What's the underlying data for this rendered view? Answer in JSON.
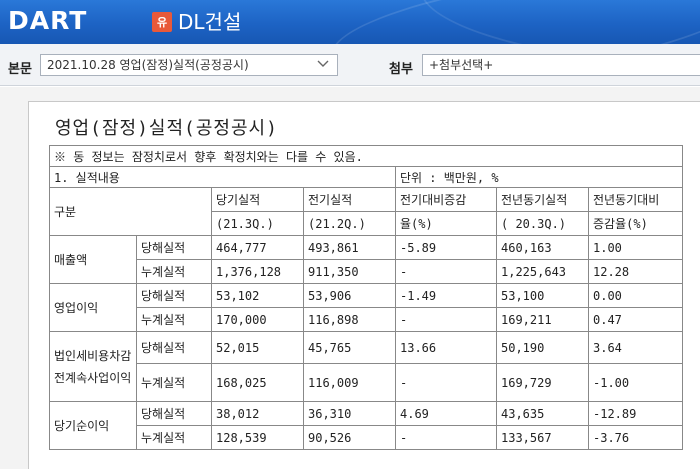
{
  "header": {
    "logo_text": "DART",
    "badge": "유",
    "company": "DL건설"
  },
  "selectors": {
    "report_label": "본문",
    "report_value": "2021.10.28  영업(잠정)실적(공정공시)",
    "attach_label": "첨부",
    "attach_value": "+첨부선택+"
  },
  "document": {
    "title": "영업(잠정)실적(공정공시)",
    "notice": "※ 동 정보는 잠정치로서 향후 확정치와는 다를 수 있음.",
    "section": "1. 실적내용",
    "unit": "단위 : 백만원, %",
    "headers": {
      "category": "구분",
      "current": "당기실적",
      "current_period": "(21.3Q.)",
      "previous": "전기실적",
      "previous_period": "(21.2Q.)",
      "qoq": "전기대비증감",
      "qoq_unit": "율(%)",
      "yoy_prev": "전년동기실적",
      "yoy_prev_period": "( 20.3Q.)",
      "yoy": "전년동기대비",
      "yoy_unit": "증감율(%)"
    },
    "rows": [
      {
        "group": "매출액",
        "items": [
          {
            "type": "당해실적",
            "current": "464,777",
            "previous": "493,861",
            "qoq": "-5.89",
            "yoy_prev": "460,163",
            "yoy": "1.00"
          },
          {
            "type": "누계실적",
            "current": "1,376,128",
            "previous": "911,350",
            "qoq": "-",
            "yoy_prev": "1,225,643",
            "yoy": "12.28"
          }
        ]
      },
      {
        "group": "영업이익",
        "items": [
          {
            "type": "당해실적",
            "current": "53,102",
            "previous": "53,906",
            "qoq": "-1.49",
            "yoy_prev": "53,100",
            "yoy": "0.00"
          },
          {
            "type": "누계실적",
            "current": "170,000",
            "previous": "116,898",
            "qoq": "-",
            "yoy_prev": "169,211",
            "yoy": "0.47"
          }
        ]
      },
      {
        "group": "법인세비용차감전계속사업이익",
        "items": [
          {
            "type": "당해실적",
            "current": "52,015",
            "previous": "45,765",
            "qoq": "13.66",
            "yoy_prev": "50,190",
            "yoy": "3.64"
          },
          {
            "type": "누계실적",
            "current": "168,025",
            "previous": "116,009",
            "qoq": "-",
            "yoy_prev": "169,729",
            "yoy": "-1.00"
          }
        ]
      },
      {
        "group": "당기순이익",
        "items": [
          {
            "type": "당해실적",
            "current": "38,012",
            "previous": "36,310",
            "qoq": "4.69",
            "yoy_prev": "43,635",
            "yoy": "-12.89"
          },
          {
            "type": "누계실적",
            "current": "128,539",
            "previous": "90,526",
            "qoq": "-",
            "yoy_prev": "133,567",
            "yoy": "-3.76"
          }
        ]
      }
    ]
  }
}
